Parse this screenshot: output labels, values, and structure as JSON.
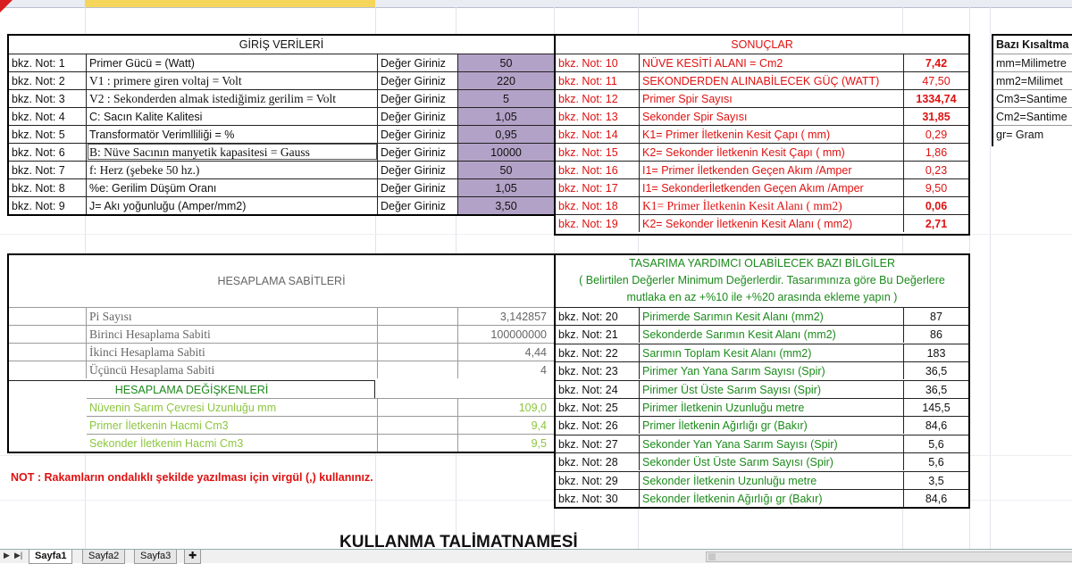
{
  "input": {
    "title": "GİRİŞ VERİLERİ",
    "value_prompt": "Değer Giriniz",
    "rows": [
      {
        "note": "bkz. Not:  1",
        "label": "Primer  Gücü =  (Watt)",
        "value": "50",
        "serif": false
      },
      {
        "note": "bkz. Not:  2",
        "label": "V1 : primere giren voltaj = Volt",
        "value": "220",
        "serif": true
      },
      {
        "note": "bkz. Not:  3",
        "label": "V2 : Sekonderden almak istediğimiz gerilim = Volt",
        "value": "5",
        "serif": true
      },
      {
        "note": "bkz. Not: 4",
        "label": "C: Sacın Kalite Kalitesi",
        "value": "1,05",
        "serif": false
      },
      {
        "note": "bkz. Not:  5",
        "label": "Transformatör Verimlliliği = %",
        "value": "0,95",
        "serif": false
      },
      {
        "note": "bkz. Not:  6",
        "label": "B: Nüve Sacının manyetik kapasitesi = Gauss",
        "value": "10000",
        "serif": true
      },
      {
        "note": "bkz. Not:  7",
        "label": " f: Herz (şebeke 50 hz.)",
        "value": "50",
        "serif": true
      },
      {
        "note": "bkz. Not:  8",
        "label": "%e: Gerilim Düşüm Oranı",
        "value": "1,05",
        "serif": false
      },
      {
        "note": "bkz. Not:  9",
        "label": "J= Akı yoğunluğu (Amper/mm2)",
        "value": "3,50",
        "serif": false
      }
    ]
  },
  "results": {
    "title": "SONUÇLAR",
    "rows": [
      {
        "note": "bkz. Not:  10",
        "label": "NÜVE KESİTİ ALANI = Cm2",
        "value": "7,42",
        "bold": true,
        "serif": false
      },
      {
        "note": "bkz. Not:  11",
        "label": "SEKONDERDEN ALINABİLECEK  GÜÇ (WATT)",
        "value": "47,50",
        "bold": false,
        "serif": false
      },
      {
        "note": "bkz. Not:  12",
        "label": "Primer Spir Sayısı",
        "value": "1334,74",
        "bold": true,
        "serif": false
      },
      {
        "note": "bkz. Not:  13",
        "label": "Sekonder Spir Sayısı",
        "value": "31,85",
        "bold": true,
        "serif": false
      },
      {
        "note": "bkz. Not:  14",
        "label": "K1= Primer İletkenin Kesit Çapı ( mm)",
        "value": "0,29",
        "bold": false,
        "serif": false
      },
      {
        "note": "bkz. Not:  15",
        "label": "K2= Sekonder İletkenin Kesit Çapı ( mm)",
        "value": "1,86",
        "bold": false,
        "serif": false
      },
      {
        "note": "bkz. Not:  16",
        "label": "I1= Primer İletkenden Geçen Akım /Amper",
        "value": "0,23",
        "bold": false,
        "serif": false
      },
      {
        "note": "bkz. Not:  17",
        "label": "I1= Sekonderİletkenden Geçen Akım /Amper",
        "value": "9,50",
        "bold": false,
        "serif": false
      },
      {
        "note": "bkz. Not:  18",
        "label": "K1= Primer İletkenin Kesit Alanı ( mm2)",
        "value": "0,06",
        "bold": true,
        "serif": true
      },
      {
        "note": "bkz. Not:  19",
        "label": "K2= Sekonder İletkenin Kesit Alanı ( mm2)",
        "value": "2,71",
        "bold": true,
        "serif": false
      }
    ]
  },
  "constants": {
    "title": "HESAPLAMA SABİTLERİ",
    "rows": [
      {
        "label": " Pi Sayısı",
        "value": "3,142857"
      },
      {
        "label": "Birinci Hesaplama Sabiti",
        "value": "100000000"
      },
      {
        "label": "İkinci Hesaplama Sabiti",
        "value": "4,44"
      },
      {
        "label": "Üçüncü Hesaplama  Sabiti",
        "value": "4"
      }
    ]
  },
  "variables": {
    "title": "HESAPLAMA DEĞİŞKENLERİ",
    "rows": [
      {
        "label": "Nüvenin Sarım Çevresi Uzunluğu mm",
        "value": "109,0"
      },
      {
        "label": "Primer İletkenin Hacmi  Cm3",
        "value": "9,4"
      },
      {
        "label": "Sekonder İletkenin Hacmi  Cm3",
        "value": "9,5"
      }
    ]
  },
  "design": {
    "title_lines": [
      "TASARIMA YARDIMCI OLABİLECEK BAZI BİLGİLER",
      "( Belirtilen Değerler Minimum Değerlerdir. Tasarımınıza göre Bu Değerlere",
      "mutlaka  en az +%10 ile +%20 arasında ekleme yapın  )"
    ],
    "rows": [
      {
        "note": "bkz. Not:  20",
        "label": "Pirimerde Sarımın Kesit Alanı (mm2)",
        "value": "87"
      },
      {
        "note": "bkz. Not:  21",
        "label": "Sekonderde Sarımın Kesit Alanı (mm2)",
        "value": "86"
      },
      {
        "note": "bkz. Not:  22",
        "label": "Sarımın Toplam Kesit Alanı (mm2)",
        "value": "183"
      },
      {
        "note": "bkz. Not:  23",
        "label": "Pirimer Yan Yana Sarım Sayısı (Spir)",
        "value": "36,5"
      },
      {
        "note": "bkz. Not:  24",
        "label": "Pirimer Üst Üste Sarım Sayısı (Spir)",
        "value": "36,5"
      },
      {
        "note": "bkz. Not:  25",
        "label": "Pirimer İletkenin Uzunluğu metre",
        "value": "145,5"
      },
      {
        "note": "bkz. Not:  26",
        "label": "Primer İletkenin Ağırlığı gr (Bakır)",
        "value": "84,6"
      },
      {
        "note": "bkz. Not:  27",
        "label": "Sekonder Yan Yana Sarım Sayısı (Spir)",
        "value": "5,6"
      },
      {
        "note": "bkz. Not:  28",
        "label": "Sekonder Üst Üste Sarım Sayısı (Spir)",
        "value": "5,6"
      },
      {
        "note": "bkz. Not:  29",
        "label": "Sekonder İletkenin Uzunluğu metre",
        "value": "3,5"
      },
      {
        "note": "bkz. Not:  30",
        "label": "Sekonder İletkenin Ağırlığı gr (Bakır)",
        "value": "84,6"
      }
    ]
  },
  "abbrev": {
    "title": "Bazı Kısaltma",
    "rows": [
      "mm=Milimetre",
      "mm2=Milimet",
      "Cm3=Santime",
      "Cm2=Santime",
      "gr= Gram"
    ]
  },
  "note_text": "NOT : Rakamların ondalıklı şekilde yazılması için virgül (,) kullanınız.",
  "instructions_title": "KULLANMA TALİMATNAMESİ",
  "sheets": [
    "Sayfa1",
    "Sayfa2",
    "Sayfa3"
  ]
}
